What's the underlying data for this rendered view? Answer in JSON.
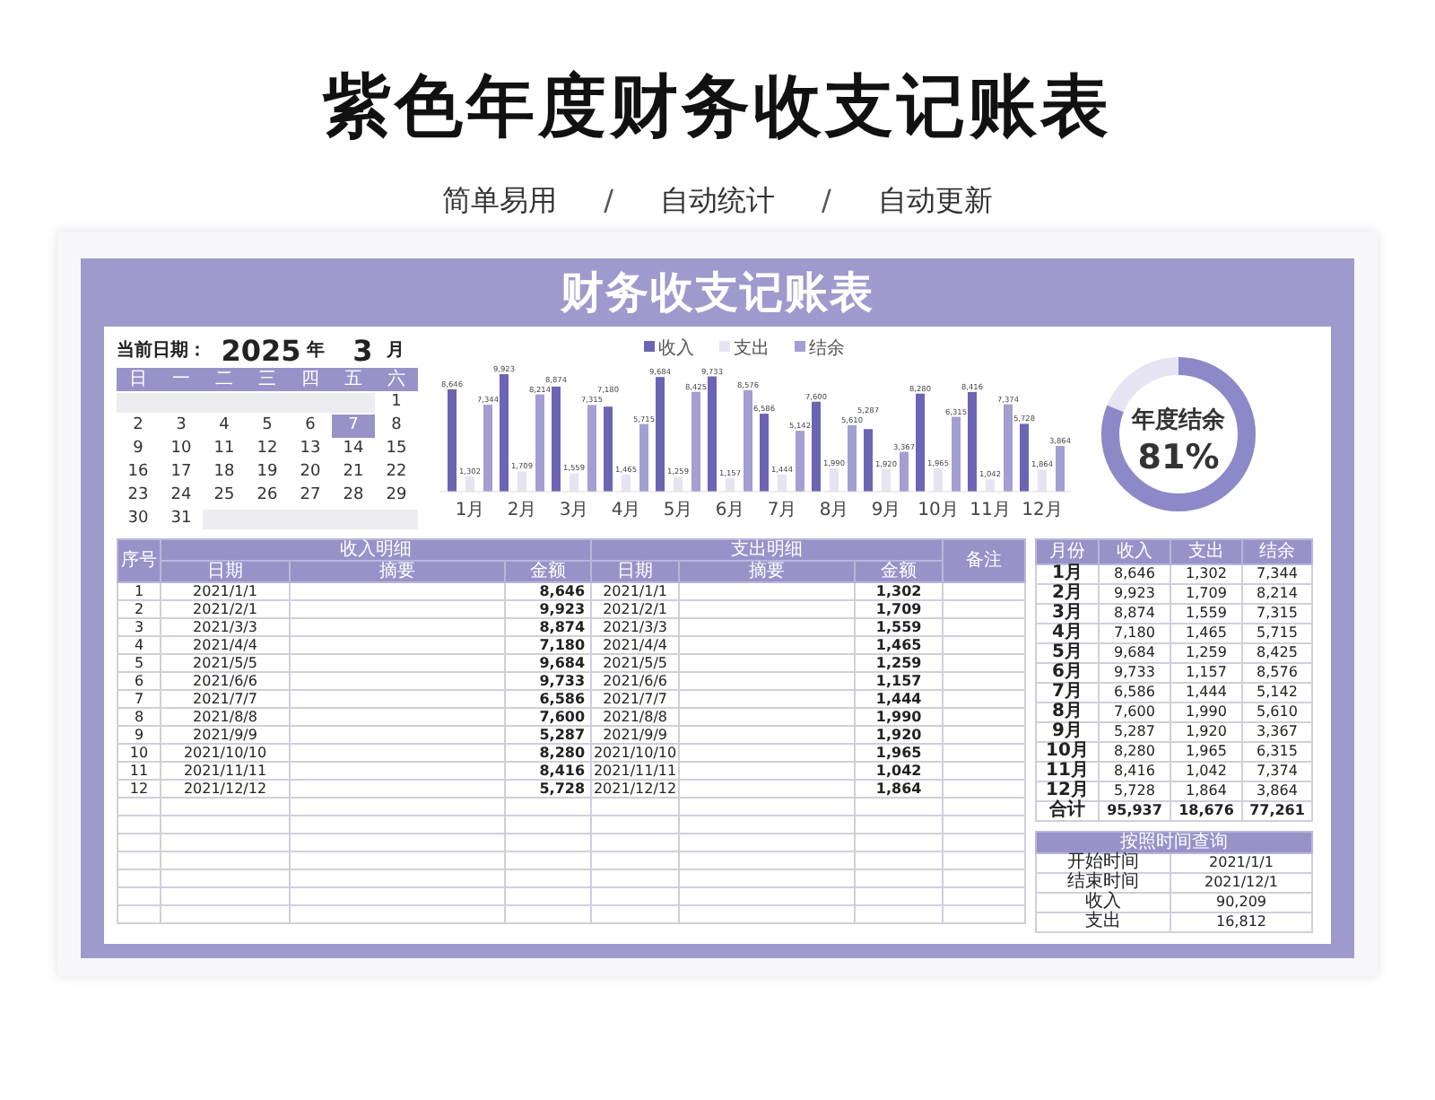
{
  "header": {
    "title": "紫色年度财务收支记账表",
    "features": [
      {
        "kind": "tag",
        "text": "简单易用"
      },
      {
        "kind": "separator",
        "text": "/"
      },
      {
        "kind": "tag",
        "text": "自动统计"
      },
      {
        "kind": "separator",
        "text": "/"
      },
      {
        "kind": "tag",
        "text": "自动更新"
      }
    ]
  },
  "sheet": {
    "title": "财务收支记账表",
    "calendar": {
      "label": "当前日期：",
      "year": "2025",
      "year_unit": "年",
      "month": "3",
      "month_unit": "月",
      "weekdays": [
        "日",
        "一",
        "二",
        "三",
        "四",
        "五",
        "六"
      ],
      "days": [
        {
          "day": "1",
          "selected": false
        },
        {
          "day": "2",
          "selected": false
        },
        {
          "day": "3",
          "selected": false
        },
        {
          "day": "4",
          "selected": false
        },
        {
          "day": "5",
          "selected": false
        },
        {
          "day": "6",
          "selected": false
        },
        {
          "day": "7",
          "selected": true
        },
        {
          "day": "8",
          "selected": false
        },
        {
          "day": "9",
          "selected": false
        },
        {
          "day": "10",
          "selected": false
        },
        {
          "day": "11",
          "selected": false
        },
        {
          "day": "12",
          "selected": false
        },
        {
          "day": "13",
          "selected": false
        },
        {
          "day": "14",
          "selected": false
        },
        {
          "day": "15",
          "selected": false
        },
        {
          "day": "16",
          "selected": false
        },
        {
          "day": "17",
          "selected": false
        },
        {
          "day": "18",
          "selected": false
        },
        {
          "day": "19",
          "selected": false
        },
        {
          "day": "20",
          "selected": false
        },
        {
          "day": "21",
          "selected": false
        },
        {
          "day": "22",
          "selected": false
        },
        {
          "day": "23",
          "selected": false
        },
        {
          "day": "24",
          "selected": false
        },
        {
          "day": "25",
          "selected": false
        },
        {
          "day": "26",
          "selected": false
        },
        {
          "day": "27",
          "selected": false
        },
        {
          "day": "28",
          "selected": false
        },
        {
          "day": "29",
          "selected": false
        },
        {
          "day": "30",
          "selected": false
        },
        {
          "day": "31",
          "selected": false
        }
      ]
    },
    "chart": {
      "chart_data": {
        "type": "bar",
        "categories": [
          "1月",
          "2月",
          "3月",
          "4月",
          "5月",
          "6月",
          "7月",
          "8月",
          "9月",
          "10月",
          "11月",
          "12月"
        ],
        "legend": "top",
        "series": [
          {
            "name": "收入",
            "color": "#6b65b3",
            "values": [
              8646,
              9923,
              8874,
              7180,
              9684,
              9733,
              6586,
              7600,
              5287,
              8280,
              8416,
              5728
            ],
            "value_labels": [
              "8,646",
              "9,923",
              "8,874",
              "7,180",
              "9,684",
              "9,733",
              "6,586",
              "7,600",
              "5,287",
              "8,280",
              "8,416",
              "5,728"
            ]
          },
          {
            "name": "支出",
            "color": "#e6e4f1",
            "values": [
              1302,
              1709,
              1559,
              1465,
              1259,
              1157,
              1444,
              1990,
              1920,
              1965,
              1042,
              1864
            ],
            "value_labels": [
              "1,302",
              "1,709",
              "1,559",
              "1,465",
              "1,259",
              "1,157",
              "1,444",
              "1,990",
              "1,920",
              "1,965",
              "1,042",
              "1,864"
            ]
          },
          {
            "name": "结余",
            "color": "#a39fd3",
            "values": [
              7344,
              8214,
              7315,
              5715,
              8425,
              8576,
              5142,
              5610,
              3367,
              6315,
              7374,
              3864
            ],
            "value_labels": [
              "7,344",
              "8,214",
              "7,315",
              "5,715",
              "8,425",
              "8,576",
              "5,142",
              "5,610",
              "3,367",
              "6,315",
              "7,374",
              "3,864"
            ]
          }
        ]
      }
    },
    "ring": {
      "label": "年度结余",
      "value": "81%",
      "level": 0.81
    },
    "ledger": {
      "index_header": "序号",
      "income_header": "收入明细",
      "expense_header": "支出明细",
      "note_header": "备注",
      "sub_headers": [
        "日期",
        "摘要",
        "金额",
        "日期",
        "摘要",
        "金额"
      ],
      "rows": [
        {
          "index": "1",
          "income_date": "2021/1/1",
          "income_amount": "8,646",
          "expense_date": "2021/1/1",
          "expense_amount": "1,302"
        },
        {
          "index": "2",
          "income_date": "2021/2/1",
          "income_amount": "9,923",
          "expense_date": "2021/2/1",
          "expense_amount": "1,709"
        },
        {
          "index": "3",
          "income_date": "2021/3/3",
          "income_amount": "8,874",
          "expense_date": "2021/3/3",
          "expense_amount": "1,559"
        },
        {
          "index": "4",
          "income_date": "2021/4/4",
          "income_amount": "7,180",
          "expense_date": "2021/4/4",
          "expense_amount": "1,465"
        },
        {
          "index": "5",
          "income_date": "2021/5/5",
          "income_amount": "9,684",
          "expense_date": "2021/5/5",
          "expense_amount": "1,259"
        },
        {
          "index": "6",
          "income_date": "2021/6/6",
          "income_amount": "9,733",
          "expense_date": "2021/6/6",
          "expense_amount": "1,157"
        },
        {
          "index": "7",
          "income_date": "2021/7/7",
          "income_amount": "6,586",
          "expense_date": "2021/7/7",
          "expense_amount": "1,444"
        },
        {
          "index": "8",
          "income_date": "2021/8/8",
          "income_amount": "7,600",
          "expense_date": "2021/8/8",
          "expense_amount": "1,990"
        },
        {
          "index": "9",
          "income_date": "2021/9/9",
          "income_amount": "5,287",
          "expense_date": "2021/9/9",
          "expense_amount": "1,920"
        },
        {
          "index": "10",
          "income_date": "2021/10/10",
          "income_amount": "8,280",
          "expense_date": "2021/10/10",
          "expense_amount": "1,965"
        },
        {
          "index": "11",
          "income_date": "2021/11/11",
          "income_amount": "8,416",
          "expense_date": "2021/11/11",
          "expense_amount": "1,042"
        },
        {
          "index": "12",
          "income_date": "2021/12/12",
          "income_amount": "5,728",
          "expense_date": "2021/12/12",
          "expense_amount": "1,864"
        }
      ]
    },
    "monthly": {
      "columns": [
        "月份",
        "收入",
        "支出",
        "结余"
      ],
      "rows": [
        [
          "1月",
          "8,646",
          "1,302",
          "7,344"
        ],
        [
          "2月",
          "9,923",
          "1,709",
          "8,214"
        ],
        [
          "3月",
          "8,874",
          "1,559",
          "7,315"
        ],
        [
          "4月",
          "7,180",
          "1,465",
          "5,715"
        ],
        [
          "5月",
          "9,684",
          "1,259",
          "8,425"
        ],
        [
          "6月",
          "9,733",
          "1,157",
          "8,576"
        ],
        [
          "7月",
          "6,586",
          "1,444",
          "5,142"
        ],
        [
          "8月",
          "7,600",
          "1,990",
          "5,610"
        ],
        [
          "9月",
          "5,287",
          "1,920",
          "3,367"
        ],
        [
          "10月",
          "8,280",
          "1,965",
          "6,315"
        ],
        [
          "11月",
          "8,416",
          "1,042",
          "7,374"
        ],
        [
          "12月",
          "5,728",
          "1,864",
          "3,864"
        ]
      ],
      "total": [
        "合计",
        "95,937",
        "18,676",
        "77,261"
      ]
    },
    "query": {
      "title": "按照时间查询",
      "rows": [
        [
          "开始时间",
          "2021/1/1"
        ],
        [
          "结束时间",
          "2021/12/1"
        ],
        [
          "收入",
          "90,209"
        ],
        [
          "支出",
          "16,812"
        ]
      ]
    }
  }
}
